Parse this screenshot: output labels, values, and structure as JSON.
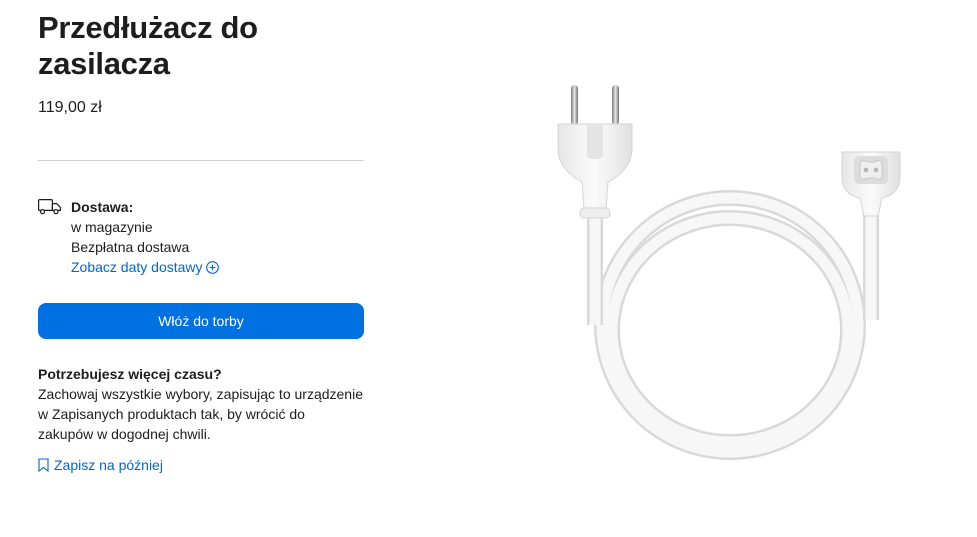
{
  "product": {
    "title": "Przedłużacz do zasilacza",
    "price": "119,00 zł"
  },
  "delivery": {
    "heading": "Dostawa:",
    "availability": "w magazynie",
    "shipping": "Bezpłatna dostawa",
    "dates_link": "Zobacz daty dostawy",
    "icon": "truck-icon"
  },
  "cart": {
    "add_button_label": "Włóż do torby",
    "accent_color": "#0071e3"
  },
  "save": {
    "heading": "Potrzebujesz więcej czasu?",
    "description": "Zachowaj wszystkie wybory, zapisując to urządzenie w Zapisanych produktach tak, by wrócić do zakupów w dogodnej chwili.",
    "link_label": "Zapisz na później",
    "icon": "bookmark-icon"
  },
  "colors": {
    "link": "#0066cc",
    "text": "#1d1d1f",
    "divider": "#d2d2d7"
  }
}
